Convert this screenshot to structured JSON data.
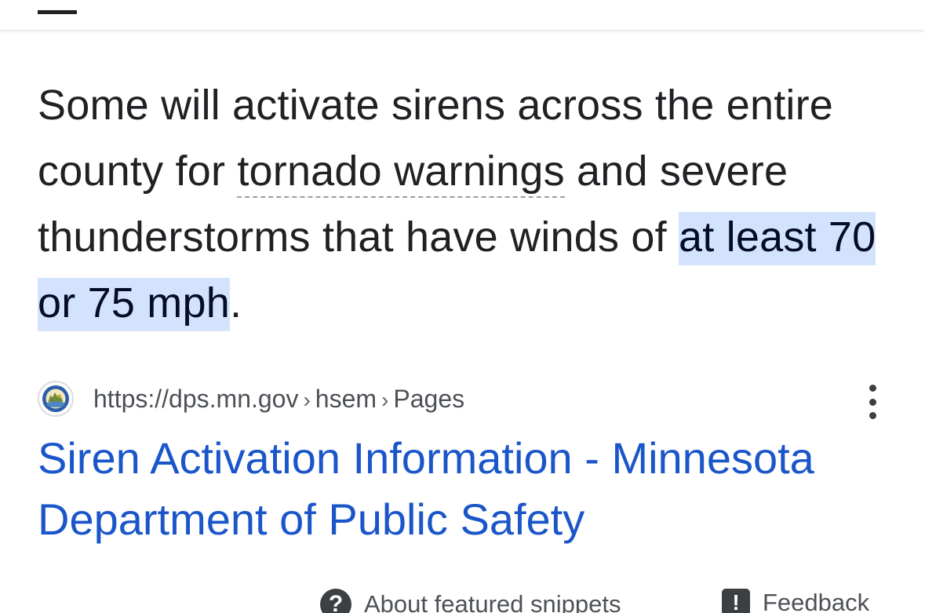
{
  "snippet": {
    "text_before_term": "Some will activate sirens across the entire county for ",
    "term": "tornado warnings",
    "text_after_term": " and severe thunderstorms that have winds of ",
    "highlighted": "at least 70 or 75 mph",
    "text_end": "."
  },
  "source": {
    "favicon": "minnesota-state-seal-icon",
    "site": "https://dps.mn.gov",
    "path": [
      "hsem",
      "Pages"
    ],
    "separator": "›"
  },
  "result": {
    "title": "Siren Activation Information - Minnesota Department of Public Safety"
  },
  "footer": {
    "about_icon": "?",
    "about_label": "About featured snippets",
    "feedback_icon": "!",
    "feedback_label": "Feedback"
  },
  "colors": {
    "highlight": "#d3e3fd",
    "link": "#1a56c9",
    "text": "#202124"
  }
}
